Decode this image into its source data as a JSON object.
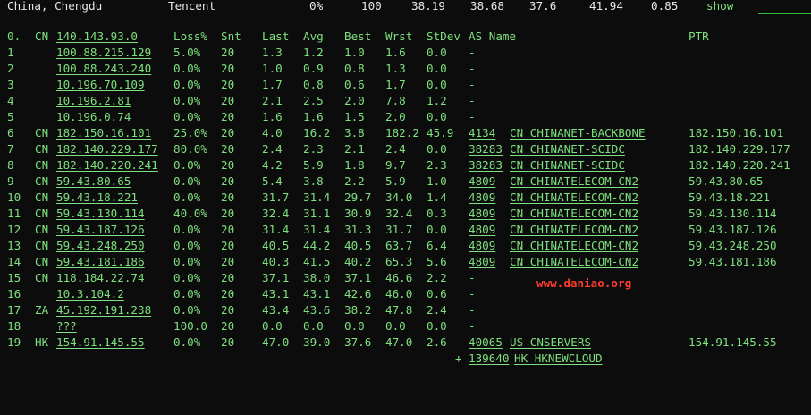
{
  "topbar": {
    "location": "China, Chengdu",
    "provider": "Tencent",
    "loss": "0%",
    "sent": "100",
    "last": "38.19",
    "avg": "38.68",
    "best": "37.6",
    "worst": "41.94",
    "stdev": "0.85",
    "show_label": "show"
  },
  "header": {
    "hop": "0.",
    "cc": "CN",
    "host": "140.143.93.0",
    "loss": "Loss%",
    "snt": "Snt",
    "last": "Last",
    "avg": "Avg",
    "best": "Best",
    "wrst": "Wrst",
    "stdev": "StDev",
    "as_name": "AS Name",
    "ptr": "PTR"
  },
  "hops": [
    {
      "hop": "1",
      "cc": "",
      "host": "100.88.215.129",
      "loss": "5.0%",
      "snt": "20",
      "last": "1.3",
      "avg": "1.2",
      "best": "1.0",
      "wrst": "1.6",
      "stdev": "0.0",
      "asn": "-",
      "as_name": "",
      "ptr": ""
    },
    {
      "hop": "2",
      "cc": "",
      "host": "100.88.243.240",
      "loss": "0.0%",
      "snt": "20",
      "last": "1.0",
      "avg": "0.9",
      "best": "0.8",
      "wrst": "1.3",
      "stdev": "0.0",
      "asn": "-",
      "as_name": "",
      "ptr": ""
    },
    {
      "hop": "3",
      "cc": "",
      "host": "10.196.70.109",
      "loss": "0.0%",
      "snt": "20",
      "last": "1.7",
      "avg": "0.8",
      "best": "0.6",
      "wrst": "1.7",
      "stdev": "0.0",
      "asn": "-",
      "as_name": "",
      "ptr": ""
    },
    {
      "hop": "4",
      "cc": "",
      "host": "10.196.2.81",
      "loss": "0.0%",
      "snt": "20",
      "last": "2.1",
      "avg": "2.5",
      "best": "2.0",
      "wrst": "7.8",
      "stdev": "1.2",
      "asn": "-",
      "as_name": "",
      "ptr": ""
    },
    {
      "hop": "5",
      "cc": "",
      "host": "10.196.0.74",
      "loss": "0.0%",
      "snt": "20",
      "last": "1.6",
      "avg": "1.6",
      "best": "1.5",
      "wrst": "2.0",
      "stdev": "0.0",
      "asn": "-",
      "as_name": "",
      "ptr": ""
    },
    {
      "hop": "6",
      "cc": "CN",
      "host": "182.150.16.101",
      "loss": "25.0%",
      "snt": "20",
      "last": "4.0",
      "avg": "16.2",
      "best": "3.8",
      "wrst": "182.2",
      "stdev": "45.9",
      "asn": "4134",
      "as_name": "CN CHINANET-BACKBONE",
      "ptr": "182.150.16.101"
    },
    {
      "hop": "7",
      "cc": "CN",
      "host": "182.140.229.177",
      "loss": "80.0%",
      "snt": "20",
      "last": "2.4",
      "avg": "2.3",
      "best": "2.1",
      "wrst": "2.4",
      "stdev": "0.0",
      "asn": "38283",
      "as_name": "CN CHINANET-SCIDC",
      "ptr": "182.140.229.177"
    },
    {
      "hop": "8",
      "cc": "CN",
      "host": "182.140.220.241",
      "loss": "0.0%",
      "snt": "20",
      "last": "4.2",
      "avg": "5.9",
      "best": "1.8",
      "wrst": "9.7",
      "stdev": "2.3",
      "asn": "38283",
      "as_name": "CN CHINANET-SCIDC",
      "ptr": "182.140.220.241"
    },
    {
      "hop": "9",
      "cc": "CN",
      "host": "59.43.80.65",
      "loss": "0.0%",
      "snt": "20",
      "last": "5.4",
      "avg": "3.8",
      "best": "2.2",
      "wrst": "5.9",
      "stdev": "1.0",
      "asn": "4809",
      "as_name": "CN CHINATELECOM-CN2",
      "ptr": "59.43.80.65"
    },
    {
      "hop": "10",
      "cc": "CN",
      "host": "59.43.18.221",
      "loss": "0.0%",
      "snt": "20",
      "last": "31.7",
      "avg": "31.4",
      "best": "29.7",
      "wrst": "34.0",
      "stdev": "1.4",
      "asn": "4809",
      "as_name": "CN CHINATELECOM-CN2",
      "ptr": "59.43.18.221"
    },
    {
      "hop": "11",
      "cc": "CN",
      "host": "59.43.130.114",
      "loss": "40.0%",
      "snt": "20",
      "last": "32.4",
      "avg": "31.1",
      "best": "30.9",
      "wrst": "32.4",
      "stdev": "0.3",
      "asn": "4809",
      "as_name": "CN CHINATELECOM-CN2",
      "ptr": "59.43.130.114"
    },
    {
      "hop": "12",
      "cc": "CN",
      "host": "59.43.187.126",
      "loss": "0.0%",
      "snt": "20",
      "last": "31.4",
      "avg": "31.4",
      "best": "31.3",
      "wrst": "31.7",
      "stdev": "0.0",
      "asn": "4809",
      "as_name": "CN CHINATELECOM-CN2",
      "ptr": "59.43.187.126"
    },
    {
      "hop": "13",
      "cc": "CN",
      "host": "59.43.248.250",
      "loss": "0.0%",
      "snt": "20",
      "last": "40.5",
      "avg": "44.2",
      "best": "40.5",
      "wrst": "63.7",
      "stdev": "6.4",
      "asn": "4809",
      "as_name": "CN CHINATELECOM-CN2",
      "ptr": "59.43.248.250"
    },
    {
      "hop": "14",
      "cc": "CN",
      "host": "59.43.181.186",
      "loss": "0.0%",
      "snt": "20",
      "last": "40.3",
      "avg": "41.5",
      "best": "40.2",
      "wrst": "65.3",
      "stdev": "5.6",
      "asn": "4809",
      "as_name": "CN CHINATELECOM-CN2",
      "ptr": "59.43.181.186"
    },
    {
      "hop": "15",
      "cc": "CN",
      "host": "118.184.22.74",
      "loss": "0.0%",
      "snt": "20",
      "last": "37.1",
      "avg": "38.0",
      "best": "37.1",
      "wrst": "46.6",
      "stdev": "2.2",
      "asn": "-",
      "as_name": "",
      "ptr": ""
    },
    {
      "hop": "16",
      "cc": "",
      "host": "10.3.104.2",
      "loss": "0.0%",
      "snt": "20",
      "last": "43.1",
      "avg": "43.1",
      "best": "42.6",
      "wrst": "46.0",
      "stdev": "0.6",
      "asn": "-",
      "as_name": "",
      "ptr": ""
    },
    {
      "hop": "17",
      "cc": "ZA",
      "host": "45.192.191.238",
      "loss": "0.0%",
      "snt": "20",
      "last": "43.4",
      "avg": "43.6",
      "best": "38.2",
      "wrst": "47.8",
      "stdev": "2.4",
      "asn": "-",
      "as_name": "",
      "ptr": ""
    },
    {
      "hop": "18",
      "cc": "",
      "host": "???",
      "loss": "100.0",
      "snt": "20",
      "last": "0.0",
      "avg": "0.0",
      "best": "0.0",
      "wrst": "0.0",
      "stdev": "0.0",
      "asn": "-",
      "as_name": "",
      "ptr": ""
    },
    {
      "hop": "19",
      "cc": "HK",
      "host": "154.91.145.55",
      "loss": "0.0%",
      "snt": "20",
      "last": "47.0",
      "avg": "39.0",
      "best": "37.6",
      "wrst": "47.0",
      "stdev": "2.6",
      "asn": "40065",
      "as_name": "US CNSERVERS",
      "ptr": "154.91.145.55"
    }
  ],
  "extra": {
    "prefix": "+",
    "asn": "139640",
    "as_name": "HK HKNEWCLOUD"
  },
  "watermark": "www.daniao.org",
  "colors": {
    "background": "#0c0c0c",
    "text": "#7ee07e",
    "header": "#e8e8e8",
    "watermark": "#ff3b30"
  }
}
